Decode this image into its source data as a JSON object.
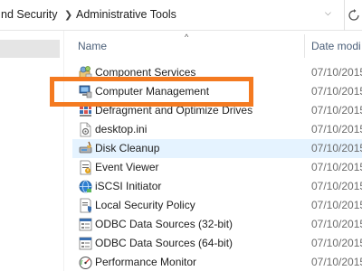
{
  "breadcrumb": {
    "parent": "nd Security",
    "current": "Administrative Tools"
  },
  "icons": {
    "separator": "chevron-right-icon",
    "dropdown": "chevron-down-icon",
    "refresh": "refresh-icon"
  },
  "columns": {
    "name": "Name",
    "date": "Date modi",
    "sort_indicator": "^"
  },
  "files": [
    {
      "name": "Component Services",
      "date": "07/10/2015",
      "icon": "component-services-icon"
    },
    {
      "name": "Computer Management",
      "date": "07/10/2015",
      "icon": "computer-management-icon"
    },
    {
      "name": "Defragment and Optimize Drives",
      "date": "07/10/2015",
      "icon": "defragment-icon"
    },
    {
      "name": "desktop.ini",
      "date": "07/10/2015",
      "icon": "ini-file-icon"
    },
    {
      "name": "Disk Cleanup",
      "date": "07/10/2015",
      "icon": "disk-cleanup-icon"
    },
    {
      "name": "Event Viewer",
      "date": "07/10/2015",
      "icon": "event-viewer-icon"
    },
    {
      "name": "iSCSI Initiator",
      "date": "07/10/2015",
      "icon": "iscsi-initiator-icon"
    },
    {
      "name": "Local Security Policy",
      "date": "07/10/2015",
      "icon": "local-security-policy-icon"
    },
    {
      "name": "ODBC Data Sources (32-bit)",
      "date": "07/10/2015",
      "icon": "odbc-icon"
    },
    {
      "name": "ODBC Data Sources (64-bit)",
      "date": "07/10/2015",
      "icon": "odbc-icon"
    },
    {
      "name": "Performance Monitor",
      "date": "07/10/2015",
      "icon": "performance-monitor-icon"
    }
  ],
  "colors": {
    "highlight_border": "#f47a20",
    "hover_row": "#e5f3ff",
    "header_text": "#4c607a"
  }
}
